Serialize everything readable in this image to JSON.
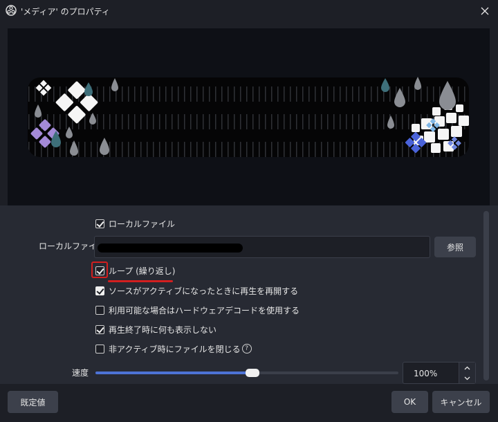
{
  "window": {
    "title": "'メディア' のプロパティ",
    "close_icon": "close-icon",
    "app_icon": "obs-icon"
  },
  "properties": {
    "local_file_checkbox": {
      "label": "ローカルファイル",
      "checked": true
    },
    "local_file_field": {
      "label": "ローカルファイル",
      "value": "",
      "browse_label": "参照"
    },
    "loop_checkbox": {
      "label": "ループ (繰り返し)",
      "checked": true
    },
    "restart_checkbox": {
      "label": "ソースがアクティブになったときに再生を再開する",
      "checked": true
    },
    "hw_decode_checkbox": {
      "label": "利用可能な場合はハードウェアデコードを使用する",
      "checked": false
    },
    "show_nothing_checkbox": {
      "label": "再生終了時に何も表示しない",
      "checked": true
    },
    "close_file_checkbox": {
      "label": "非アクティブ時にファイルを閉じる",
      "checked": false,
      "help_icon": "help-icon"
    },
    "speed": {
      "label": "速度",
      "value": "100%",
      "level": 0.5
    }
  },
  "footer": {
    "defaults_label": "既定値",
    "ok_label": "OK",
    "cancel_label": "キャンセル"
  },
  "colors": {
    "background": "#1d1f26",
    "panel": "#272a33",
    "accent": "#4d73d6",
    "annotation": "#d31f1f"
  }
}
